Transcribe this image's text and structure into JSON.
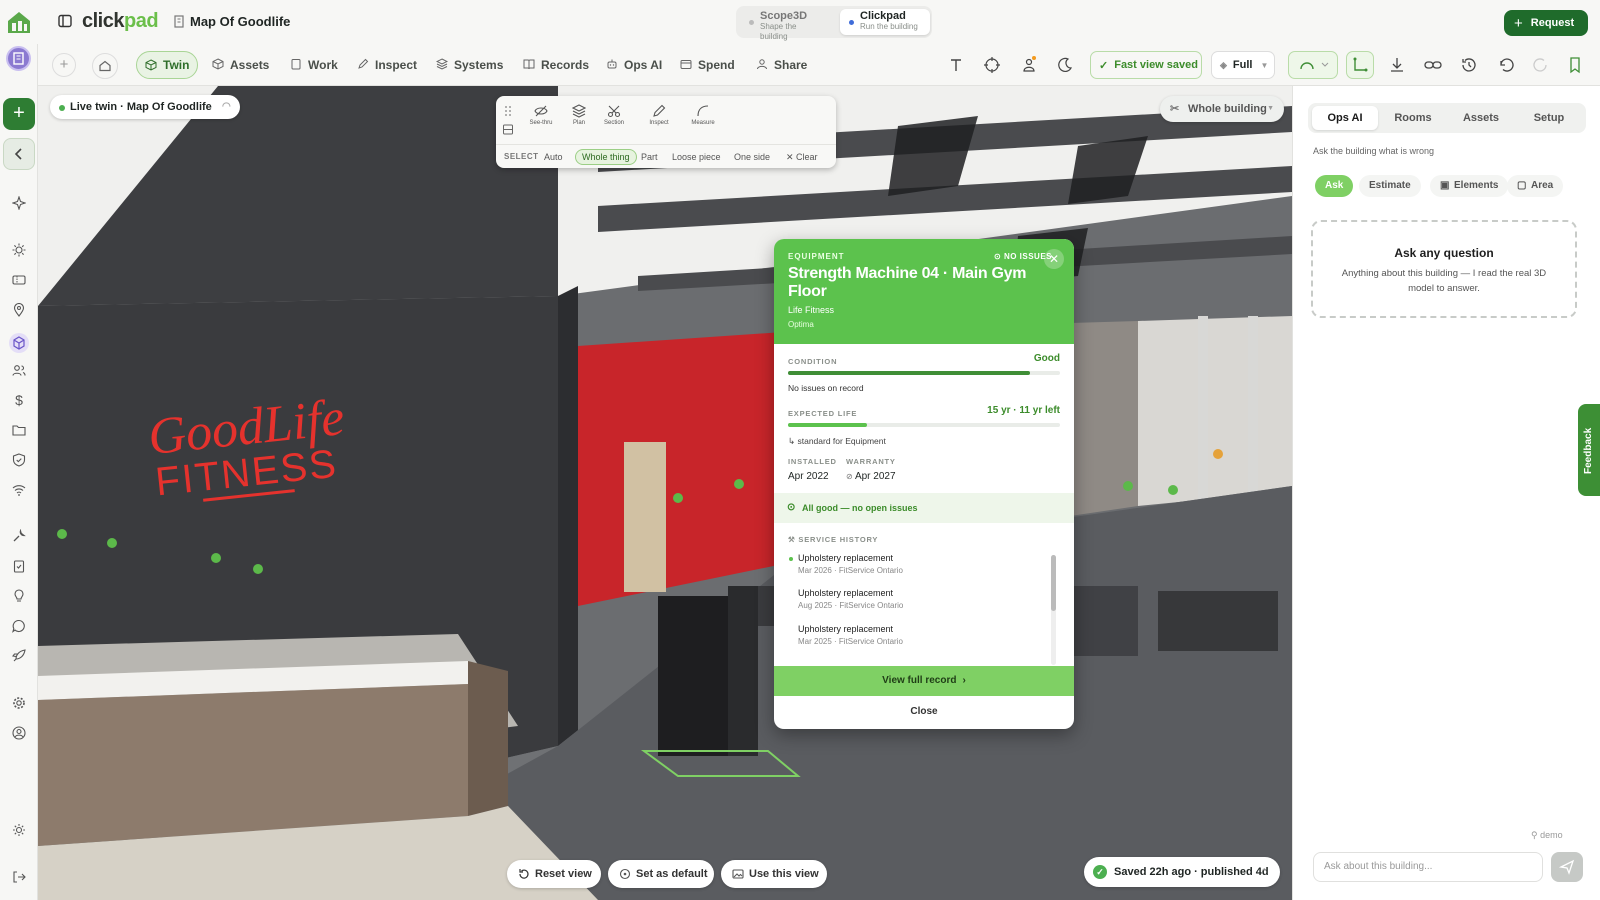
{
  "app": {
    "brand_left": "click",
    "brand_right": "pad",
    "project": "Map Of Goodlife"
  },
  "switcher": [
    {
      "title": "Scope3D",
      "subtitle": "Shape the building",
      "active": false
    },
    {
      "title": "Clickpad",
      "subtitle": "Run the building",
      "active": true
    }
  ],
  "request_label": "Request",
  "nav": [
    {
      "label": "Twin",
      "icon": "cube-icon",
      "active": true
    },
    {
      "label": "Assets",
      "icon": "box-icon"
    },
    {
      "label": "Work",
      "icon": "clipboard-icon"
    },
    {
      "label": "Inspect",
      "icon": "pencil-icon"
    },
    {
      "label": "Systems",
      "icon": "layers-icon"
    },
    {
      "label": "Records",
      "icon": "book-icon"
    },
    {
      "label": "Ops AI",
      "icon": "robot-icon"
    },
    {
      "label": "Spend",
      "icon": "wallet-icon"
    },
    {
      "label": "Share",
      "icon": "people-icon"
    }
  ],
  "toolbar": {
    "fast_view": "Fast view saved",
    "mode": "Full"
  },
  "viewport": {
    "live_chip": "Live twin · Map Of Goodlife",
    "scope": "Whole building",
    "wall_sign_line1": "GoodLife",
    "wall_sign_line2": "FITNESS"
  },
  "tools": [
    {
      "label": "See-thru",
      "icon": "eye-off-icon"
    },
    {
      "label": "Plan",
      "icon": "layers-icon"
    },
    {
      "label": "Section",
      "icon": "scissors-icon"
    },
    {
      "label": "Inspect",
      "icon": "pencil-icon"
    },
    {
      "label": "Measure",
      "icon": "curve-icon"
    }
  ],
  "select": {
    "label": "SELECT",
    "options": [
      "Auto",
      "Whole thing",
      "Part",
      "Loose piece",
      "One side"
    ],
    "active": "Whole thing",
    "clear": "Clear"
  },
  "card": {
    "type": "EQUIPMENT",
    "status": "NO ISSUES",
    "title": "Strength Machine 04 · Main Gym Floor",
    "brand": "Life Fitness",
    "model": "Optima",
    "condition_label": "CONDITION",
    "condition_value": "Good",
    "condition_level": 0.89,
    "condition_note": "No issues on record",
    "life_label": "EXPECTED LIFE",
    "life_value": "15 yr · 11 yr left",
    "life_level": 0.29,
    "life_note": "standard for Equipment",
    "installed_label": "INSTALLED",
    "installed_value": "Apr 2022",
    "warranty_label": "WARRANTY",
    "warranty_value": "Apr 2027",
    "all_good": "All good — no open issues",
    "history_label": "SERVICE HISTORY",
    "history": [
      {
        "title": "Upholstery replacement",
        "meta": "Mar 2026 · FitService Ontario"
      },
      {
        "title": "Upholstery replacement",
        "meta": "Aug 2025 · FitService Ontario"
      },
      {
        "title": "Upholstery replacement",
        "meta": "Mar 2025 · FitService Ontario"
      }
    ],
    "view_record": "View full record",
    "close": "Close"
  },
  "view_buttons": {
    "reset": "Reset view",
    "default": "Set as default",
    "use": "Use this view"
  },
  "saved_status": "Saved 22h ago · published 4d",
  "right_panel": {
    "tabs": [
      "Ops AI",
      "Rooms",
      "Assets",
      "Setup"
    ],
    "active_tab": "Ops AI",
    "subtitle": "Ask the building what is wrong",
    "modes": [
      "Ask",
      "Estimate",
      "Elements",
      "Area"
    ],
    "active_mode": "Ask",
    "ask_title": "Ask any question",
    "ask_body": "Anything about this building — I read the real 3D model to answer.",
    "user": "demo",
    "input_placeholder": "Ask about this building..."
  },
  "feedback_label": "Feedback",
  "colors": {
    "accent": "#5cc24d",
    "accent_dark": "#1f6b2b",
    "wall_red": "#c8252a"
  }
}
